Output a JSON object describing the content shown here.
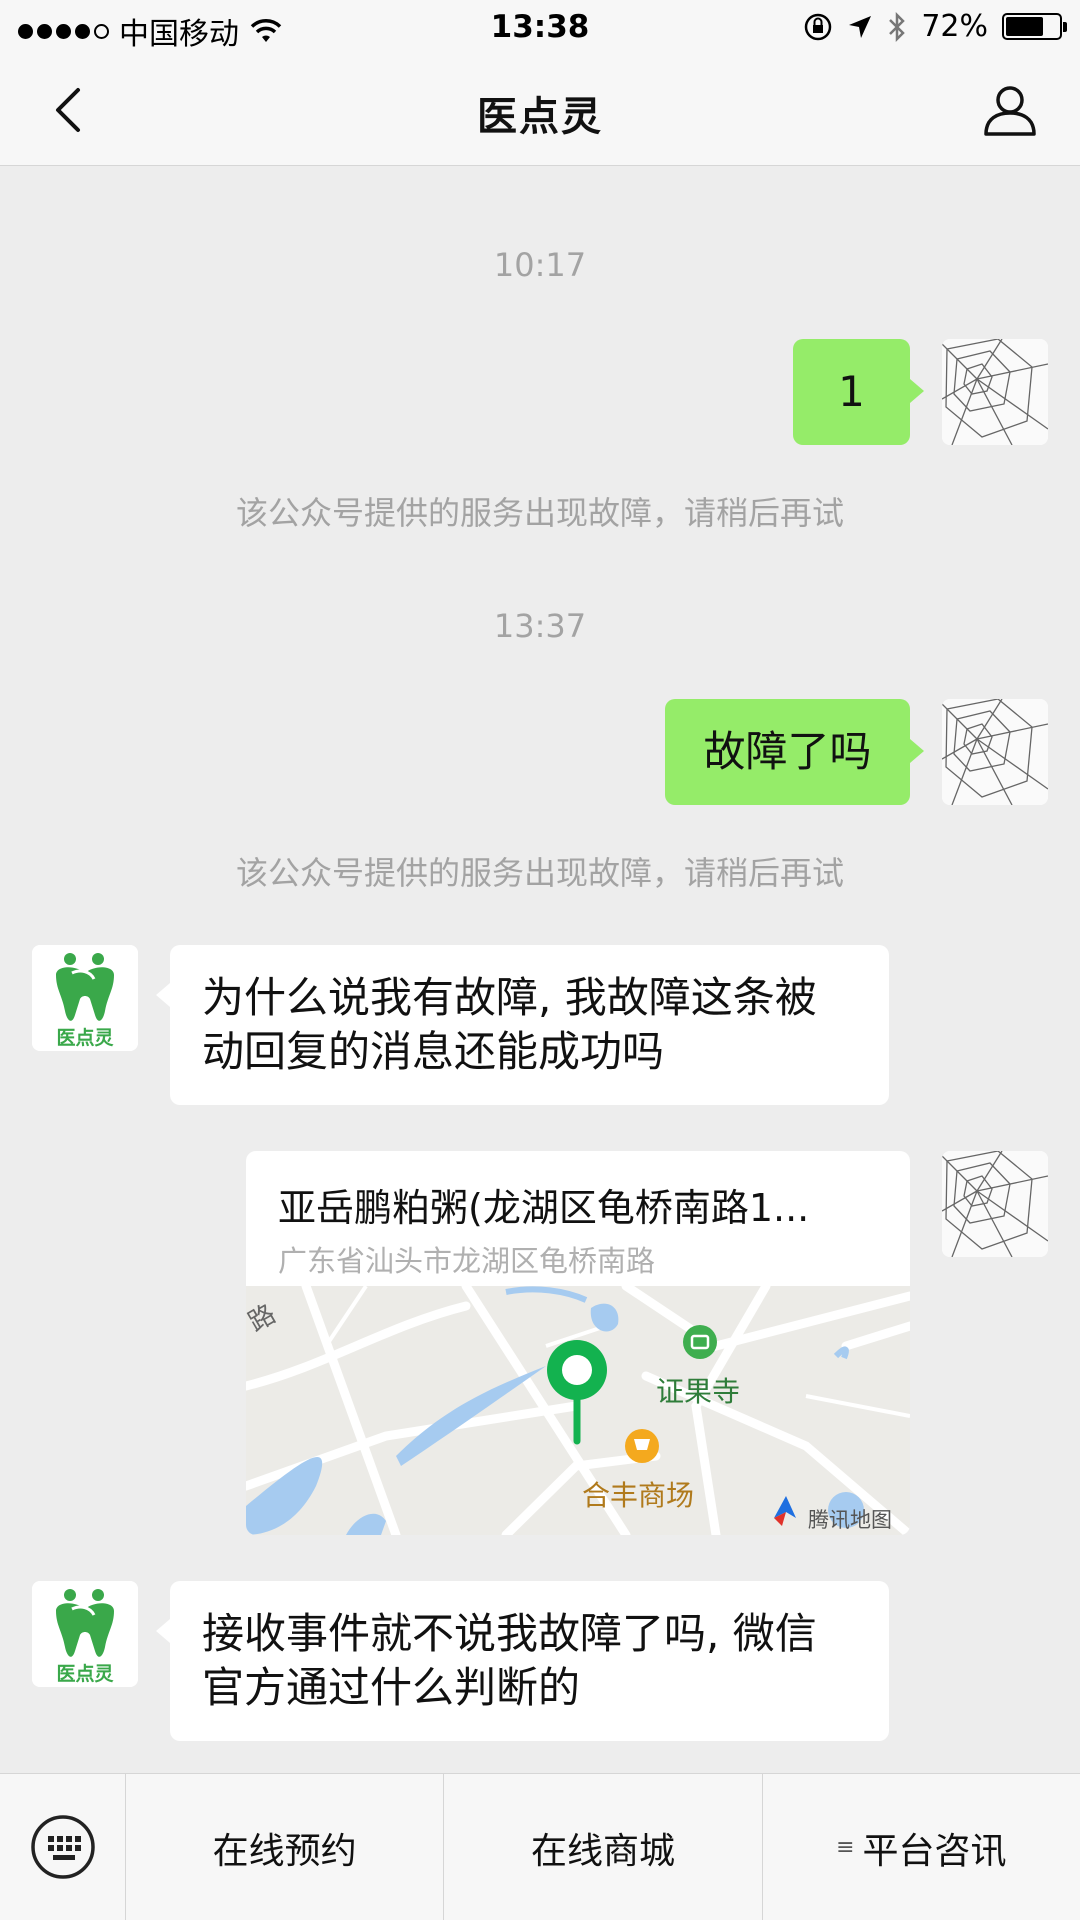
{
  "status_bar": {
    "carrier": "中国移动",
    "time": "13:38",
    "battery": "72%",
    "battery_level": 0.72
  },
  "nav": {
    "title": "医点灵"
  },
  "chat": {
    "timestamp_1": "10:17",
    "msg_1": "1",
    "system_1": "该公众号提供的服务出现故障，请稍后再试",
    "timestamp_2": "13:37",
    "msg_2": "故障了吗",
    "system_2": "该公众号提供的服务出现故障，请稍后再试",
    "reply_1_line_1": "为什么说我有故障, 我故障这条被",
    "reply_1_line_2": "动回复的消息还能成功吗",
    "location": {
      "title": "亚岳鹏粕粥(龙湖区龟桥南路1...",
      "address": "广东省汕头市龙湖区龟桥南路",
      "map_label_temple": "证果寺",
      "map_label_mall": "合丰商场",
      "map_road": "路",
      "map_brand": "腾讯地图"
    },
    "reply_2_line_1": "接收事件就不说我故障了吗, 微信",
    "reply_2_line_2": "官方通过什么判断的"
  },
  "official_account": {
    "logo_text": "医点灵"
  },
  "menu": {
    "item_1": "在线预约",
    "item_2": "在线商城",
    "item_3": "平台咨讯"
  },
  "colors": {
    "my_bubble": "#95ec69",
    "their_bubble": "#ffffff",
    "background": "#ededed",
    "brand_green": "#3aa84a"
  }
}
